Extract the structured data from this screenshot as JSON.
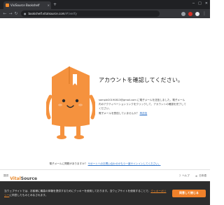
{
  "browser": {
    "tab_title": "VisiSource Bookshelf",
    "tab_close": "×",
    "new_tab": "+",
    "url_host": "bookshelf.vitalsource.com",
    "url_path": "/#/verify",
    "controls": {
      "minimize": "─",
      "maximize": "□",
      "close": "✕"
    },
    "extension_colors": [
      "#9aa0a6",
      "#d93025",
      "#e8eaed"
    ]
  },
  "page": {
    "heading": "アカウントを確認してください。",
    "body_email": "sample20190813@gmail.com",
    "body_text": " に電子メールを送信しました。電子メール内のアクティベーションリンクをクリックして、アカウントの確認を完了してください。",
    "resend_prompt": "電子メールを受信していませんか？",
    "resend_link": "再送信",
    "help_prompt": "電子メールに問題がありますか？",
    "help_link": "サポートへのお問い合わせかもう一度サインインしてください。",
    "mascot_color": "#f5923e"
  },
  "footer": {
    "powered_by": "提供",
    "brand_part1": "Vital",
    "brand_part2": "Source",
    "help_label": "ヘルプ",
    "language_label": "日本語"
  },
  "cookie_banner": {
    "text_before": "当ウェブサイトでは、お客様に最高の体験を提供するためにクッキーを使用しております。当ウェブサイトを使用することで、",
    "policy_link": "クッキーポリシー",
    "text_after": "に同意したものとみなされます。",
    "accept_button": "同意して閉じる"
  }
}
